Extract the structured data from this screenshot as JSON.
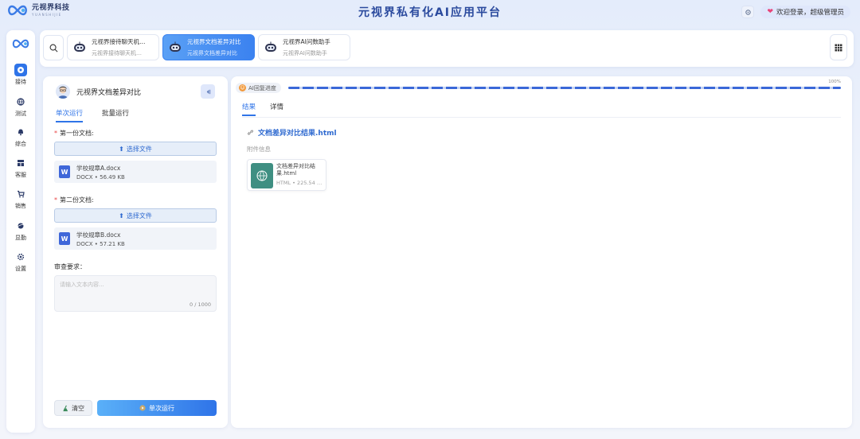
{
  "header": {
    "logo_main": "元视界科技",
    "logo_sub": "YUANSHIJIE",
    "title": "元视界私有化AI应用平台",
    "user_greeting": "欢迎登录，超级管理员"
  },
  "rail": {
    "items": [
      {
        "label": "接待",
        "icon": "chat-bubble-icon",
        "active": true
      },
      {
        "label": "测试",
        "icon": "globe-icon"
      },
      {
        "label": "综合",
        "icon": "bell-icon"
      },
      {
        "label": "客服",
        "icon": "grid-panel-icon"
      },
      {
        "label": "销售",
        "icon": "cart-icon"
      },
      {
        "label": "显勤",
        "icon": "planet-icon"
      },
      {
        "label": "设置",
        "icon": "gear-icon"
      }
    ]
  },
  "tabs": [
    {
      "title": "元视界接待聊天机…",
      "subtitle": "元视界接待聊天机…",
      "active": false
    },
    {
      "title": "元视界文档差异对比",
      "subtitle": "元视界文档差异对比",
      "active": true
    },
    {
      "title": "元视界AI问数助手",
      "subtitle": "元视界AI问数助手",
      "active": false
    }
  ],
  "left_panel": {
    "title": "元视界文档差异对比",
    "subtabs": [
      "单次运行",
      "批量运行"
    ],
    "doc1_label": "第一份文档:",
    "doc2_label": "第二份文档:",
    "upload_label": "选择文件",
    "file1": {
      "name": "学校规章A.docx",
      "meta": "DOCX • 56.49 KB"
    },
    "file2": {
      "name": "学校规章B.docx",
      "meta": "DOCX • 57.21 KB"
    },
    "review_label": "审查要求：",
    "review_placeholder": "请输入文本内容...",
    "review_count": "0 / 1000",
    "clear_label": "清空",
    "run_label": "单次运行"
  },
  "right_panel": {
    "progress_label": "AI回复进度",
    "progress_pct": "100%",
    "progress_value": 100,
    "tabs": [
      "结果",
      "详情"
    ],
    "result_link": "文档差异对比结果.html",
    "attach_label": "附件信息",
    "attachment": {
      "name": "文档差异对比结果.html",
      "meta": "HTML • 225.54 …"
    }
  },
  "colors": {
    "accent": "#2f74e8",
    "brand": "#2b4a9e"
  }
}
